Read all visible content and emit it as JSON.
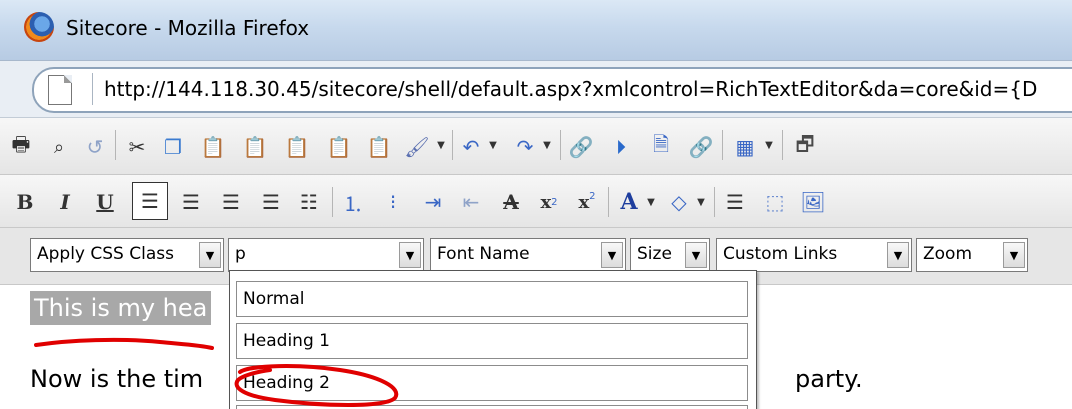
{
  "window": {
    "title": "Sitecore - Mozilla Firefox"
  },
  "address_bar": {
    "url": "http://144.118.30.45/sitecore/shell/default.aspx?xmlcontrol=RichTextEditor&da=core&id={D"
  },
  "toolbar_format": {
    "bold": "B",
    "italic": "I",
    "underline": "U",
    "strike": "A",
    "subscript": "x",
    "superscript": "x",
    "forecolor": "A"
  },
  "toolbar_selects": {
    "css_class": "Apply CSS Class",
    "paragraph": "p",
    "font_name": "Font Name",
    "size": "Size",
    "custom_links": "Custom Links",
    "zoom": "Zoom"
  },
  "paragraph_dropdown": {
    "items": [
      "Normal",
      "Heading 1",
      "Heading 2"
    ]
  },
  "editor": {
    "heading_text": "This is my hea",
    "para_left": "Now is the tim",
    "para_right": "party."
  },
  "annotation_color": "#e00000"
}
